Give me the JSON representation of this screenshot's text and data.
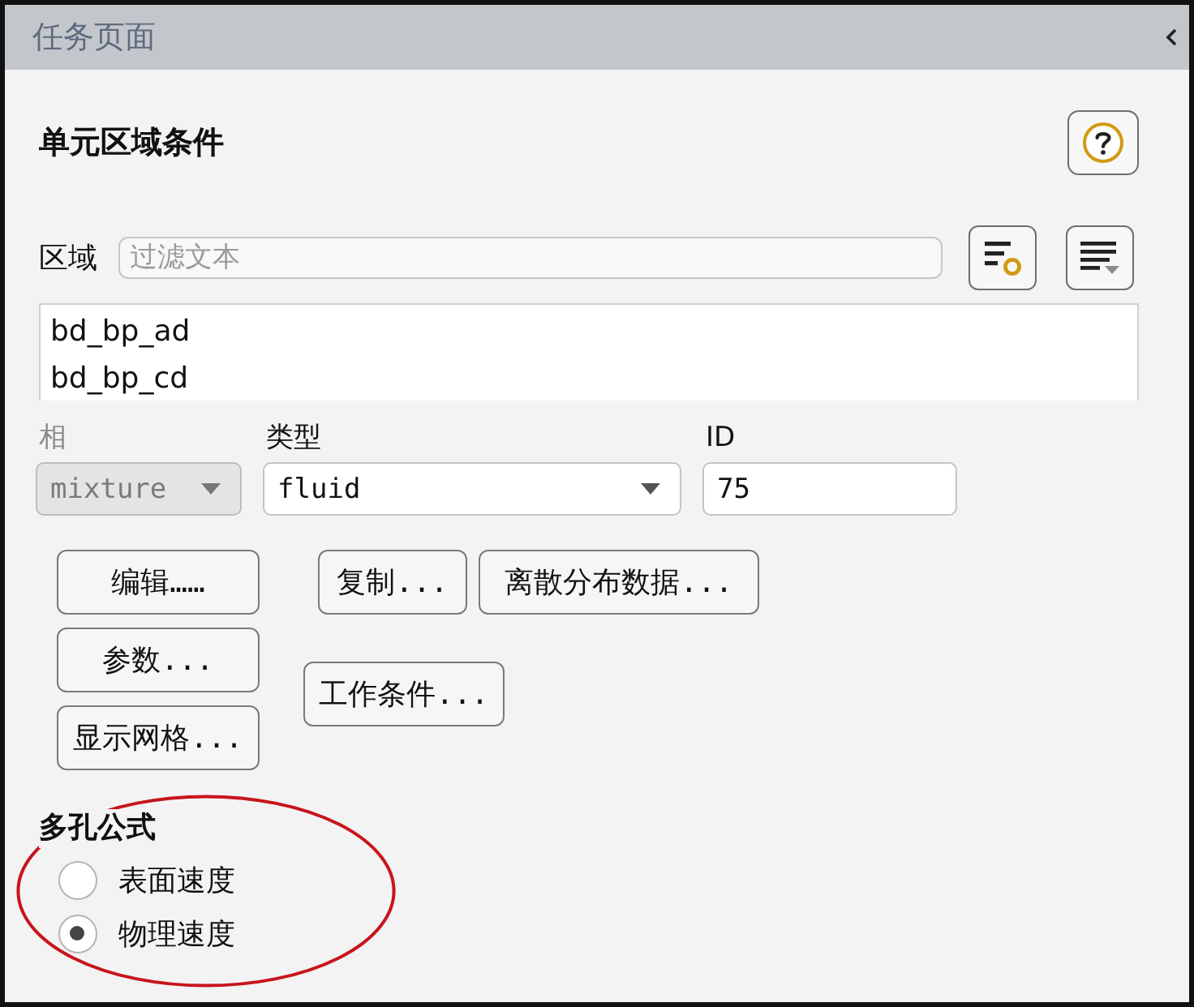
{
  "task_page": {
    "title": "任务页面"
  },
  "panel": {
    "title": "单元区域条件"
  },
  "zone": {
    "label": "区域",
    "placeholder": "过滤文本",
    "items": [
      {
        "name": "bd_bp_ad",
        "selected": false
      },
      {
        "name": "bd_bp_cd",
        "selected": false
      }
    ]
  },
  "fields": [
    {
      "kind": "dropdown",
      "label": "相",
      "value": "mixture",
      "disabled": true
    },
    {
      "kind": "dropdown",
      "label": "类型",
      "value": "fluid",
      "disabled": false
    },
    {
      "kind": "text",
      "label": "ID",
      "value": "75",
      "disabled": false
    }
  ],
  "buttons": {
    "left": [
      "编辑……",
      "参数...",
      "显示网格..."
    ],
    "right": [
      [
        "复制...",
        "离散分布数据..."
      ],
      [
        "工作条件..."
      ]
    ]
  },
  "porous_formulation": {
    "label": "多孔公式",
    "options": [
      {
        "label": "表面速度",
        "selected": false
      },
      {
        "label": "物理速度",
        "selected": true
      }
    ]
  },
  "highlight": {
    "kind": "ellipse"
  }
}
